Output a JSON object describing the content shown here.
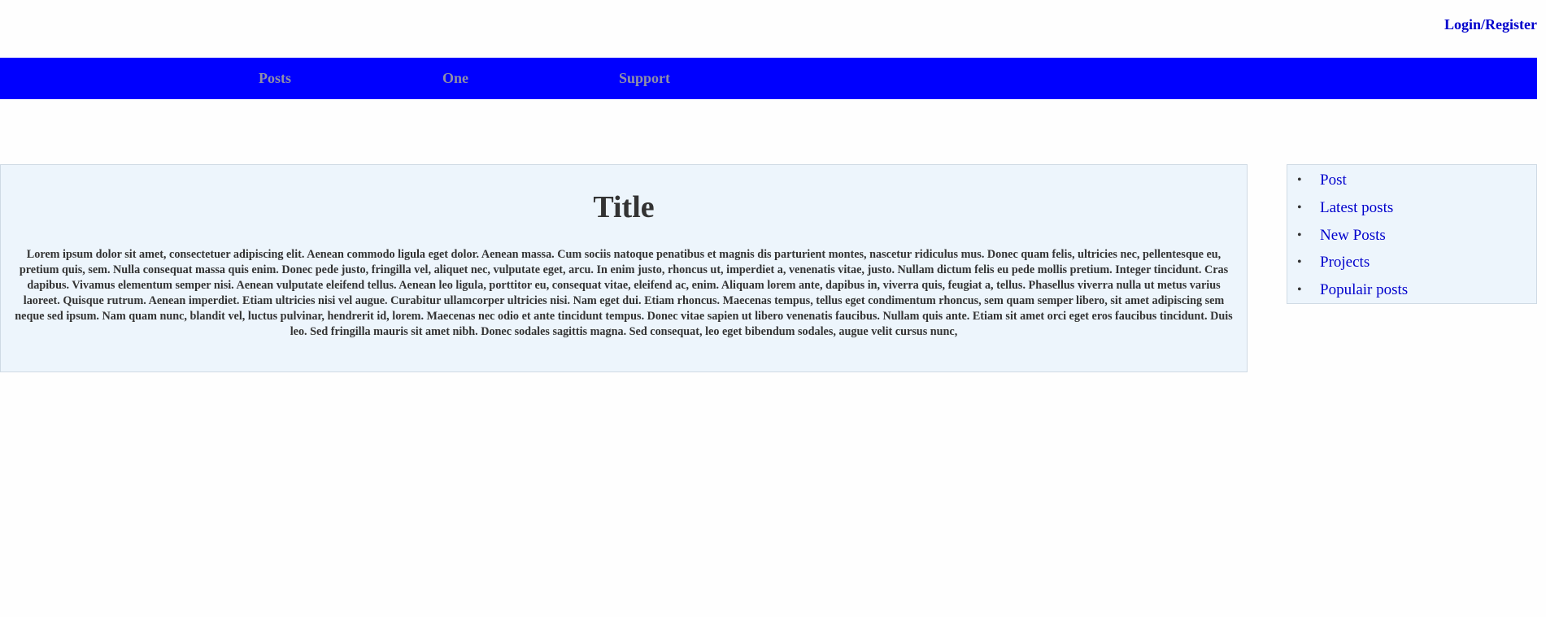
{
  "header": {
    "login_label": "Login/Register"
  },
  "nav": {
    "items": [
      {
        "label": "Posts"
      },
      {
        "label": "One"
      },
      {
        "label": "Support"
      }
    ]
  },
  "article": {
    "title": "Title",
    "body": "Lorem ipsum dolor sit amet, consectetuer adipiscing elit. Aenean commodo ligula eget dolor. Aenean massa. Cum sociis natoque penatibus et magnis dis parturient montes, nascetur ridiculus mus. Donec quam felis, ultricies nec, pellentesque eu, pretium quis, sem. Nulla consequat massa quis enim. Donec pede justo, fringilla vel, aliquet nec, vulputate eget, arcu. In enim justo, rhoncus ut, imperdiet a, venenatis vitae, justo. Nullam dictum felis eu pede mollis pretium. Integer tincidunt. Cras dapibus. Vivamus elementum semper nisi. Aenean vulputate eleifend tellus. Aenean leo ligula, porttitor eu, consequat vitae, eleifend ac, enim. Aliquam lorem ante, dapibus in, viverra quis, feugiat a, tellus. Phasellus viverra nulla ut metus varius laoreet. Quisque rutrum. Aenean imperdiet. Etiam ultricies nisi vel augue. Curabitur ullamcorper ultricies nisi. Nam eget dui. Etiam rhoncus. Maecenas tempus, tellus eget condimentum rhoncus, sem quam semper libero, sit amet adipiscing sem neque sed ipsum. Nam quam nunc, blandit vel, luctus pulvinar, hendrerit id, lorem. Maecenas nec odio et ante tincidunt tempus. Donec vitae sapien ut libero venenatis faucibus. Nullam quis ante. Etiam sit amet orci eget eros faucibus tincidunt. Duis leo. Sed fringilla mauris sit amet nibh. Donec sodales sagittis magna. Sed consequat, leo eget bibendum sodales, augue velit cursus nunc,"
  },
  "sidebar": {
    "bullet": "•",
    "items": [
      {
        "label": "Post"
      },
      {
        "label": "Latest posts"
      },
      {
        "label": "New Posts"
      },
      {
        "label": "Projects"
      },
      {
        "label": "Populair posts"
      }
    ]
  },
  "colors": {
    "nav_background": "#0000ff",
    "nav_text": "#8f8fa8",
    "link": "#0000cc",
    "panel_background": "#edf5fc",
    "panel_border": "#cfdae4",
    "body_text": "#333333"
  }
}
